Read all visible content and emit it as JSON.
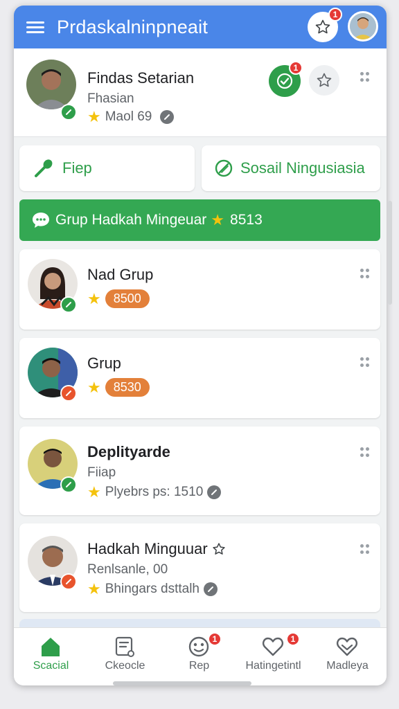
{
  "app_bar": {
    "title": "Prdaskalninpneait",
    "notif_badge": "1"
  },
  "profile": {
    "name": "Findas Setarian",
    "role": "Fhasian",
    "meta": "Maol 69",
    "verify_badge": "1"
  },
  "actions": {
    "primary_label": "Fiep",
    "secondary_label": "Sosail Ningusiasia"
  },
  "group_bar": {
    "label": "Grup Hadkah Mingeuar",
    "count": "8513"
  },
  "people": [
    {
      "name": "Nad Grup",
      "score": "8500",
      "status": "green"
    },
    {
      "name": "Grup",
      "score": "8530",
      "status": "red"
    },
    {
      "name": "Deplityarde",
      "sub": "Fiiap",
      "meta": "Plyebrs ps: 1510",
      "status": "green"
    },
    {
      "name": "Hadkah Minguuar",
      "sub": "Renlsanle, 00",
      "meta": "Bhingars dsttalh",
      "status": "red"
    }
  ],
  "bottom_nav": [
    {
      "label": "Scacial",
      "icon": "home-icon",
      "active": true
    },
    {
      "label": "Ckeocle",
      "icon": "document-icon",
      "active": false
    },
    {
      "label": "Rep",
      "icon": "smiley-icon",
      "badge": "1",
      "active": false
    },
    {
      "label": "Hatingetintl",
      "icon": "heart-icon",
      "badge": "1",
      "active": false
    },
    {
      "label": "Madleya",
      "icon": "heart-outline-icon",
      "active": false
    }
  ],
  "colors": {
    "app_bar": "#4a86e8",
    "accent_green": "#34a853",
    "badge_red": "#e53935",
    "pill_orange": "#e3803a"
  }
}
